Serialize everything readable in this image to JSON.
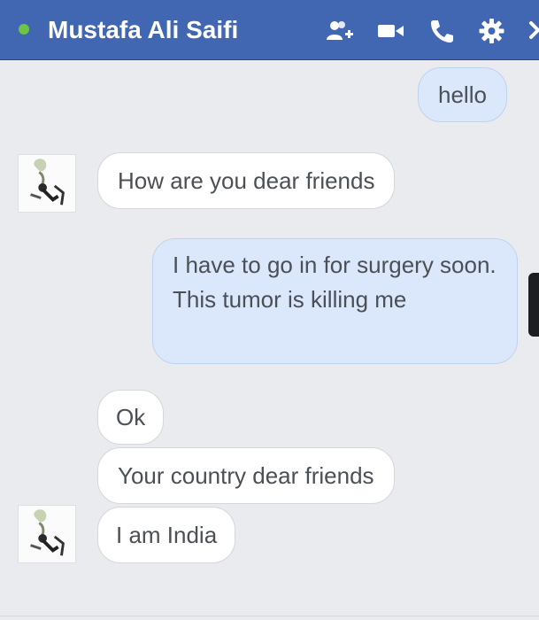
{
  "header": {
    "contact_name": "Mustafa Ali Saifi",
    "status": "online",
    "icons": [
      "add-friend-icon",
      "video-call-icon",
      "phone-icon",
      "gear-icon",
      "close-icon"
    ]
  },
  "messages": [
    {
      "direction": "outgoing",
      "text": "hello"
    },
    {
      "direction": "incoming",
      "text": "How are you dear friends"
    },
    {
      "direction": "outgoing",
      "text": "I have to go in for surgery soon. This tumor is killing me"
    },
    {
      "direction": "incoming",
      "text": "Ok"
    },
    {
      "direction": "incoming",
      "text": "Your country dear friends"
    },
    {
      "direction": "incoming",
      "text": "I am India"
    }
  ],
  "colors": {
    "header_bg": "#4267b2",
    "online_dot": "#6cc644",
    "outgoing_bubble": "#dbe8fb",
    "incoming_bubble": "#ffffff",
    "chat_bg": "#e9ebee"
  }
}
